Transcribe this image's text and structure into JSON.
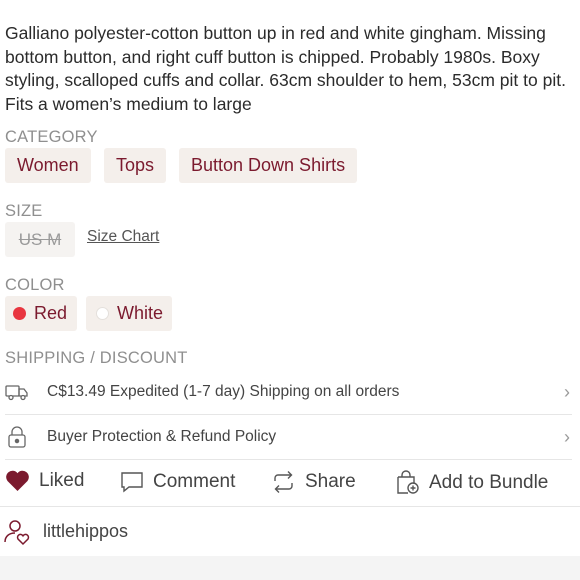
{
  "listing": {
    "description": "Galliano polyester-cotton button up in red and white gingham. Missing bottom button, and right cuff button is chipped. Probably 1980s. Boxy styling, scalloped cuffs and collar. 63cm shoulder to hem, 53cm pit to pit. Fits a women’s medium to large"
  },
  "category": {
    "label": "CATEGORY",
    "items": [
      "Women",
      "Tops",
      "Button Down Shirts"
    ]
  },
  "size": {
    "label": "SIZE",
    "value": "US M",
    "chart_link": "Size Chart"
  },
  "color": {
    "label": "COLOR",
    "options": [
      {
        "name": "Red",
        "swatch": "#e8353f"
      },
      {
        "name": "White",
        "swatch": "#ffffff"
      }
    ]
  },
  "shipping": {
    "label": "SHIPPING / DISCOUNT",
    "rows": [
      {
        "text": "C$13.49 Expedited (1-7 day) Shipping on all orders",
        "icon": "truck-icon"
      },
      {
        "text": "Buyer Protection & Refund Policy",
        "icon": "lock-icon"
      }
    ]
  },
  "actions": {
    "like": "Liked",
    "comment": "Comment",
    "share": "Share",
    "bundle": "Add to Bundle"
  },
  "seller": {
    "username": "littlehippos"
  },
  "colors": {
    "accent": "#7b1a2e",
    "chip_bg": "#f4efeb",
    "heart": "#7b1a2e"
  }
}
